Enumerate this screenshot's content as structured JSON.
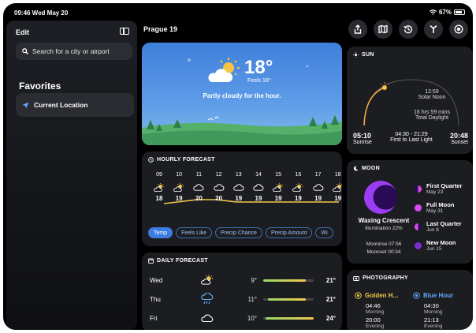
{
  "status_bar": {
    "time_date": "09:46  Wed May 20",
    "battery": "67%"
  },
  "sidebar": {
    "edit_label": "Edit",
    "search_placeholder": "Search for a city or airport",
    "favorites_title": "Favorites",
    "items": [
      {
        "label": "Current Location"
      }
    ]
  },
  "header": {
    "title": "Prague 19"
  },
  "toolbar": {
    "icons": [
      "share-icon",
      "map-icon",
      "history-icon",
      "antenna-icon",
      "target-icon",
      "play-icon"
    ]
  },
  "current": {
    "temp": "18°",
    "feels": "Feels 18°",
    "description": "Partly cloudy for the hour."
  },
  "hourly": {
    "title": "HOURLY FORECAST",
    "hours": [
      {
        "hour": "09",
        "icon": "sun-cloud",
        "temp": "18"
      },
      {
        "hour": "10",
        "icon": "sun-cloud",
        "temp": "19"
      },
      {
        "hour": "11",
        "icon": "cloud",
        "temp": "20"
      },
      {
        "hour": "12",
        "icon": "cloud",
        "temp": "20"
      },
      {
        "hour": "13",
        "icon": "cloud",
        "temp": "19"
      },
      {
        "hour": "14",
        "icon": "cloud",
        "temp": "19"
      },
      {
        "hour": "15",
        "icon": "sun-cloud",
        "temp": "19"
      },
      {
        "hour": "16",
        "icon": "sun-cloud",
        "temp": "19"
      },
      {
        "hour": "17",
        "icon": "cloud",
        "temp": "19"
      },
      {
        "hour": "18",
        "icon": "sun-cloud",
        "temp": "19"
      }
    ],
    "chips": [
      "Temp",
      "Feels Like",
      "Precip Chance",
      "Precip Amount",
      "Wi"
    ]
  },
  "daily": {
    "title": "DAILY FORECAST",
    "days": [
      {
        "day": "Wed",
        "icon": "sun-cloud",
        "low": "9°",
        "high": "21°",
        "range": [
          0.0,
          0.85
        ]
      },
      {
        "day": "Thu",
        "icon": "rain",
        "low": "11°",
        "high": "21°",
        "range": [
          0.1,
          0.85
        ]
      },
      {
        "day": "Fri",
        "icon": "cloud",
        "low": "10°",
        "high": "24°",
        "range": [
          0.05,
          1.0
        ]
      }
    ]
  },
  "sun": {
    "title": "SUN",
    "solar_noon_time": "12:59",
    "solar_noon_label": "Solar Noon",
    "daylight_value": "16 hrs 59 mins",
    "daylight_label": "Total Daylight",
    "sunrise_time": "05:10",
    "sunrise_label": "Sunrise",
    "light_range": "04:30 - 21:29",
    "light_label": "First to Last Light",
    "sunset_time": "20:48",
    "sunset_label": "Sunset"
  },
  "moon": {
    "title": "MOON",
    "phase_name": "Waxing Crescent",
    "illumination": "Illumination 22%",
    "moonrise": "Moonrise 07:56",
    "moonset": "Moonset 00:34",
    "phases": [
      {
        "name": "First Quarter",
        "date": "May 23"
      },
      {
        "name": "Full Moon",
        "date": "May 31"
      },
      {
        "name": "Last Quarter",
        "date": "Jun 8"
      },
      {
        "name": "New Moon",
        "date": "Jun 15"
      }
    ]
  },
  "photography": {
    "title": "PHOTOGRAPHY",
    "golden": {
      "name": "Golden H...",
      "morning": "04:46",
      "morning_label": "Morning",
      "evening": "20:00",
      "evening_label": "Evening"
    },
    "blue": {
      "name": "Blue Hour",
      "morning": "04:30",
      "morning_label": "Morning",
      "evening": "21:13",
      "evening_label": "Evening"
    }
  },
  "colors": {
    "accent": "#3b7de0",
    "golden": "#f2c94c",
    "moon": "#9b3df0"
  }
}
